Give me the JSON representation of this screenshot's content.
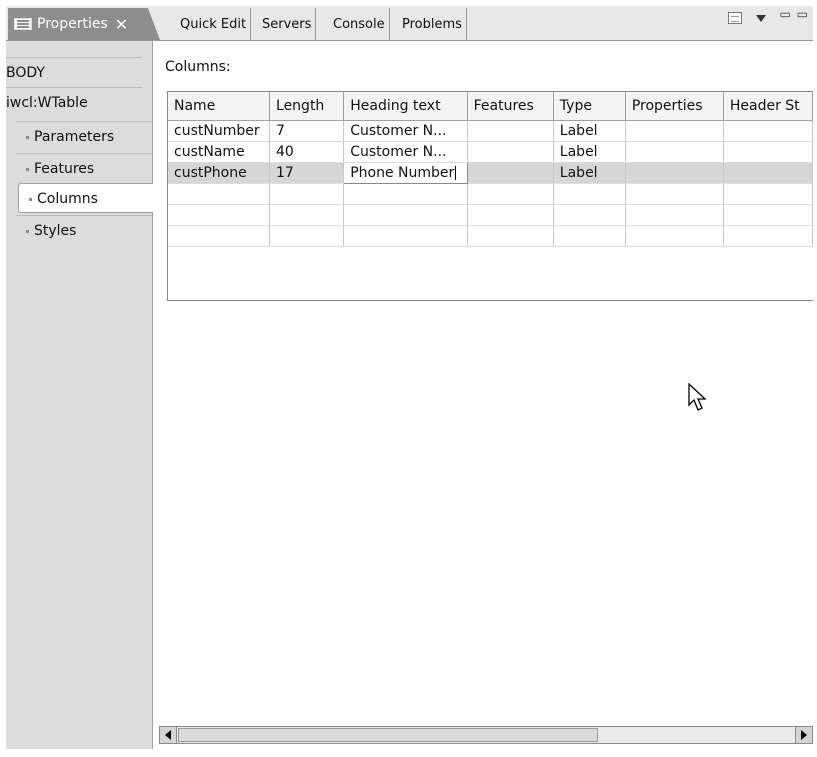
{
  "tabs": {
    "active": {
      "label": "Properties",
      "icon": "properties-view-icon",
      "close_icon": "close-icon"
    },
    "others": [
      "Quick Edit",
      "Servers",
      "Console",
      "Problems"
    ]
  },
  "toolbar": {
    "view_menu_icon": "view-menu-icon",
    "dropdown_icon": "chevron-down-icon",
    "minimize_maximize": "▭ ▭"
  },
  "nav": {
    "items": [
      {
        "label": "BODY",
        "level": 0
      },
      {
        "label": "iwcl:WTable",
        "level": 0
      },
      {
        "label": "Parameters",
        "level": 1
      },
      {
        "label": "Features",
        "level": 1
      },
      {
        "label": "Columns",
        "level": 1,
        "selected": true
      },
      {
        "label": "Styles",
        "level": 1
      }
    ]
  },
  "main": {
    "columns_label": "Columns:",
    "table": {
      "headers": [
        "Name",
        "Length",
        "Heading text",
        "Features",
        "Type",
        "Properties",
        "Header St"
      ],
      "rows": [
        [
          "custNumber",
          "7",
          "Customer N...",
          "",
          "Label",
          "",
          ""
        ],
        [
          "custName",
          "40",
          "Customer N...",
          "",
          "Label",
          "",
          ""
        ],
        [
          "custPhone",
          "17",
          "Phone Number",
          "",
          "Label",
          "",
          ""
        ]
      ],
      "selected_row": 2,
      "editing_cell": "Heading text"
    }
  },
  "colors": {
    "tab_active": "#8d8d8d",
    "nav_bg": "#dcdcdc",
    "selected_row": "#d6d6d6"
  }
}
